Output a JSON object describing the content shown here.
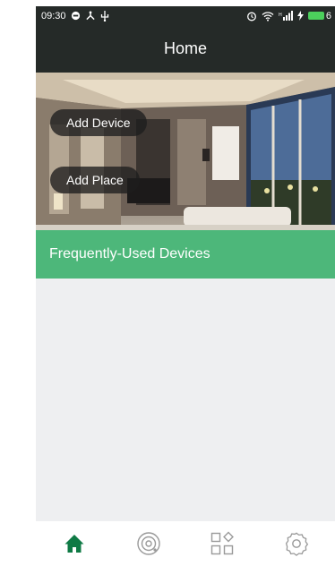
{
  "status_bar": {
    "time": "09:30",
    "battery_level": "6"
  },
  "header": {
    "title": "Home"
  },
  "hero": {
    "add_device_label": "Add Device",
    "add_place_label": "Add Place",
    "section_label": "Frequently-Used Devices"
  },
  "tab_bar": {
    "items": [
      {
        "icon": "home-icon",
        "active": true
      },
      {
        "icon": "target-icon",
        "active": false
      },
      {
        "icon": "apps-icon",
        "active": false
      },
      {
        "icon": "settings-icon",
        "active": false
      }
    ]
  },
  "colors": {
    "header_bg": "#252a28",
    "accent_green": "#36b26e",
    "active_tab": "#0f7a45",
    "inactive_tab": "#9a9a9a",
    "content_bg": "#eeeff1"
  }
}
